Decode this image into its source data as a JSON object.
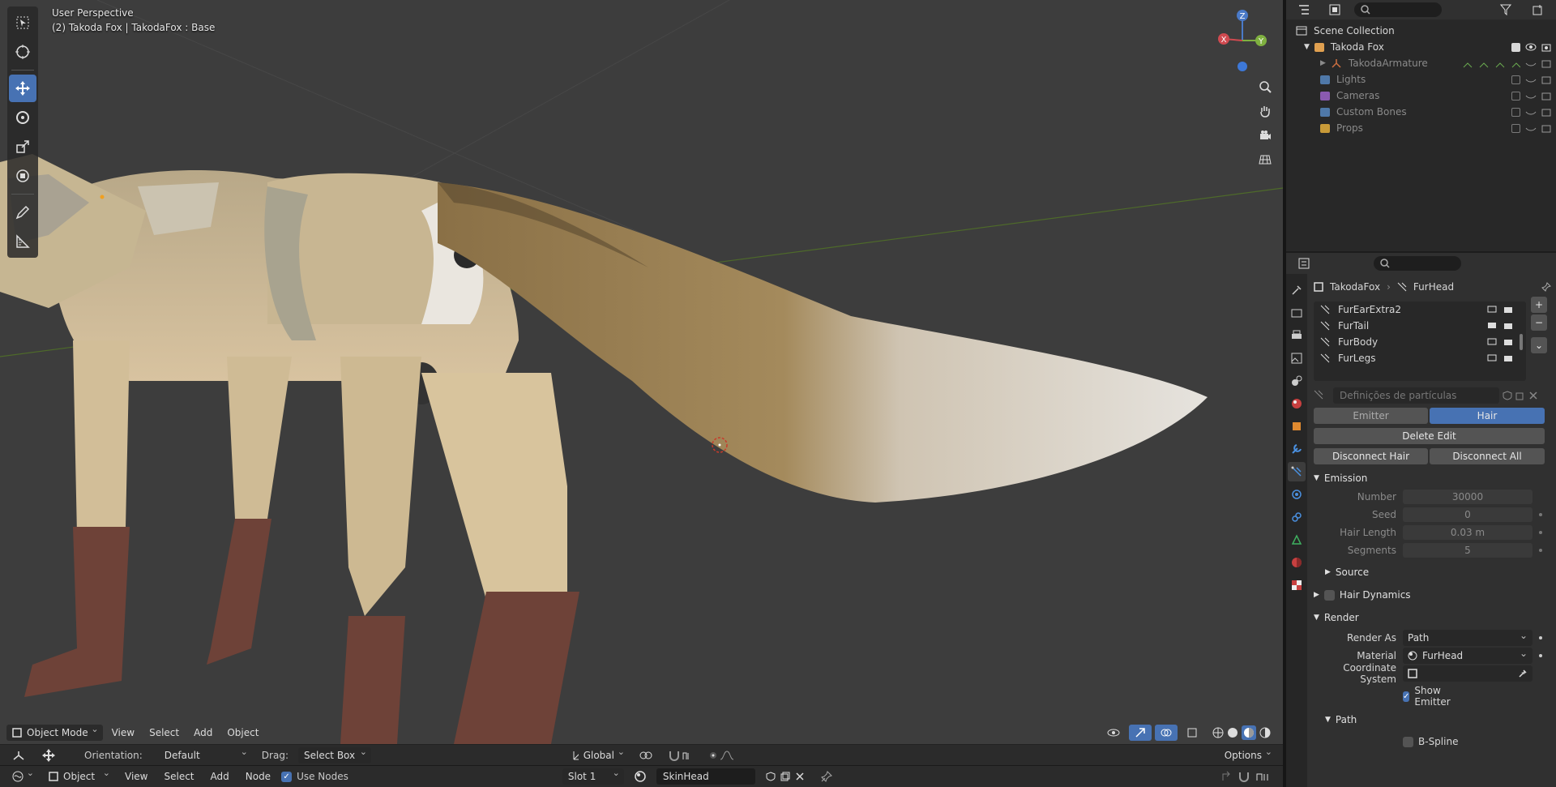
{
  "viewport": {
    "title": "User Perspective",
    "subtitle": "(2) Takoda Fox | TakodaFox : Base",
    "header": {
      "mode": "Object Mode",
      "menus": [
        "View",
        "Select",
        "Add",
        "Object"
      ]
    },
    "gizmo": {
      "z": "Z",
      "x": "X",
      "y": "Y"
    }
  },
  "tool_settings": {
    "orientation_label": "Orientation:",
    "orientation_value": "Default",
    "drag_label": "Drag:",
    "drag_value": "Select Box",
    "transform_orientation": "Global",
    "options_label": "Options"
  },
  "node_bar": {
    "editor": "Object",
    "menus": [
      "View",
      "Select",
      "Add",
      "Node"
    ],
    "use_nodes_label": "Use Nodes",
    "slot": "Slot 1",
    "material": "SkinHead"
  },
  "outliner": {
    "root": "Scene Collection",
    "items": [
      {
        "label": "Takoda Fox",
        "color": "#e0a050",
        "dim": false
      },
      {
        "label": "TakodaArmature",
        "color": "#d07040",
        "dim": true
      },
      {
        "label": "Lights",
        "color": "#4f78a8",
        "dim": true
      },
      {
        "label": "Cameras",
        "color": "#8a5ab0",
        "dim": true
      },
      {
        "label": "Custom Bones",
        "color": "#4f78a8",
        "dim": true
      },
      {
        "label": "Props",
        "color": "#c89a38",
        "dim": true
      }
    ]
  },
  "properties": {
    "breadcrumb_object": "TakodaFox",
    "breadcrumb_psys": "FurHead",
    "particle_systems": [
      "FurEarExtra2",
      "FurTail",
      "FurBody",
      "FurLegs"
    ],
    "settings_placeholder": "Definições de partículas",
    "type_emitter": "Emitter",
    "type_hair": "Hair",
    "delete_edit": "Delete Edit",
    "disconnect_hair": "Disconnect Hair",
    "disconnect_all": "Disconnect All",
    "emission": {
      "title": "Emission",
      "number_label": "Number",
      "number_value": "30000",
      "seed_label": "Seed",
      "seed_value": "0",
      "hair_length_label": "Hair Length",
      "hair_length_value": "0.03 m",
      "segments_label": "Segments",
      "segments_value": "5"
    },
    "source_label": "Source",
    "hair_dynamics_label": "Hair Dynamics",
    "render": {
      "title": "Render",
      "render_as_label": "Render As",
      "render_as_value": "Path",
      "material_label": "Material",
      "material_value": "FurHead",
      "coord_label": "Coordinate System",
      "show_emitter_label": "Show Emitter"
    },
    "path_label": "Path",
    "bspline_label": "B-Spline"
  }
}
